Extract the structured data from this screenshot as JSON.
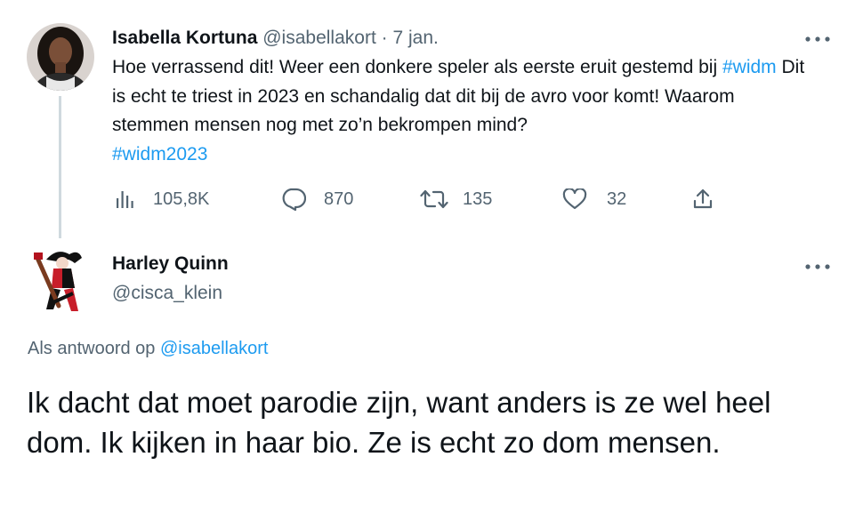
{
  "parent_tweet": {
    "author_name": "Isabella Kortuna",
    "author_handle": "@isabellakort",
    "separator": "·",
    "time": "7 jan.",
    "text_part1": "Hoe verrassend dit! Weer een donkere speler als eerste eruit gestemd bij ",
    "hashtag1": "#widm",
    "text_part2": " Dit is echt te triest in 2023 en schandalig dat dit bij de avro voor komt! Waarom stemmen mensen nog met zo’n bekrompen mind?",
    "hashtag2": "#widm2023",
    "more_icon": "more-horizontal-icon",
    "actions": {
      "views": {
        "icon": "views-icon",
        "count": "105,8K"
      },
      "replies": {
        "icon": "reply-icon",
        "count": "870"
      },
      "retweets": {
        "icon": "retweet-icon",
        "count": "135"
      },
      "likes": {
        "icon": "heart-icon",
        "count": "32"
      },
      "share": {
        "icon": "share-icon"
      }
    }
  },
  "reply_tweet": {
    "author_name": "Harley Quinn",
    "author_handle": "@cisca_klein",
    "replying_to_label": "Als antwoord op ",
    "replying_to_mention": "@isabellakort",
    "more_icon": "more-horizontal-icon",
    "text": "Ik dacht dat moet parodie zijn, want anders is ze wel heel dom. Ik kijken in haar bio. Ze is echt zo dom mensen."
  },
  "colors": {
    "text_primary": "#0f1419",
    "text_secondary": "#536471",
    "link": "#1d9bf0",
    "thread_line": "#cfd9de"
  }
}
